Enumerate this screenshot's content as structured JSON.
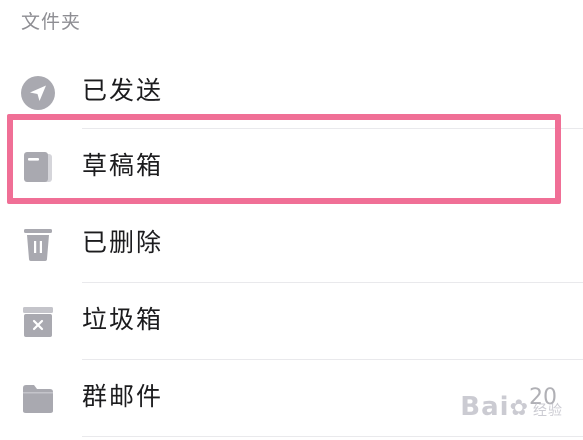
{
  "section": {
    "title": "文件夹"
  },
  "folders": [
    {
      "label": "已发送",
      "icon": "paper-plane-icon"
    },
    {
      "label": "草稿箱",
      "icon": "draft-icon"
    },
    {
      "label": "已删除",
      "icon": "trash-icon"
    },
    {
      "label": "垃圾箱",
      "icon": "spam-box-icon"
    },
    {
      "label": "群邮件",
      "icon": "folder-icon",
      "count": "20"
    }
  ],
  "watermark": {
    "text": "Bai",
    "suffix": "经验"
  },
  "colors": {
    "highlight": "#f06f96",
    "icon": "#a9a9b0",
    "text": "#1c1c1e",
    "muted": "#8e8e93"
  }
}
